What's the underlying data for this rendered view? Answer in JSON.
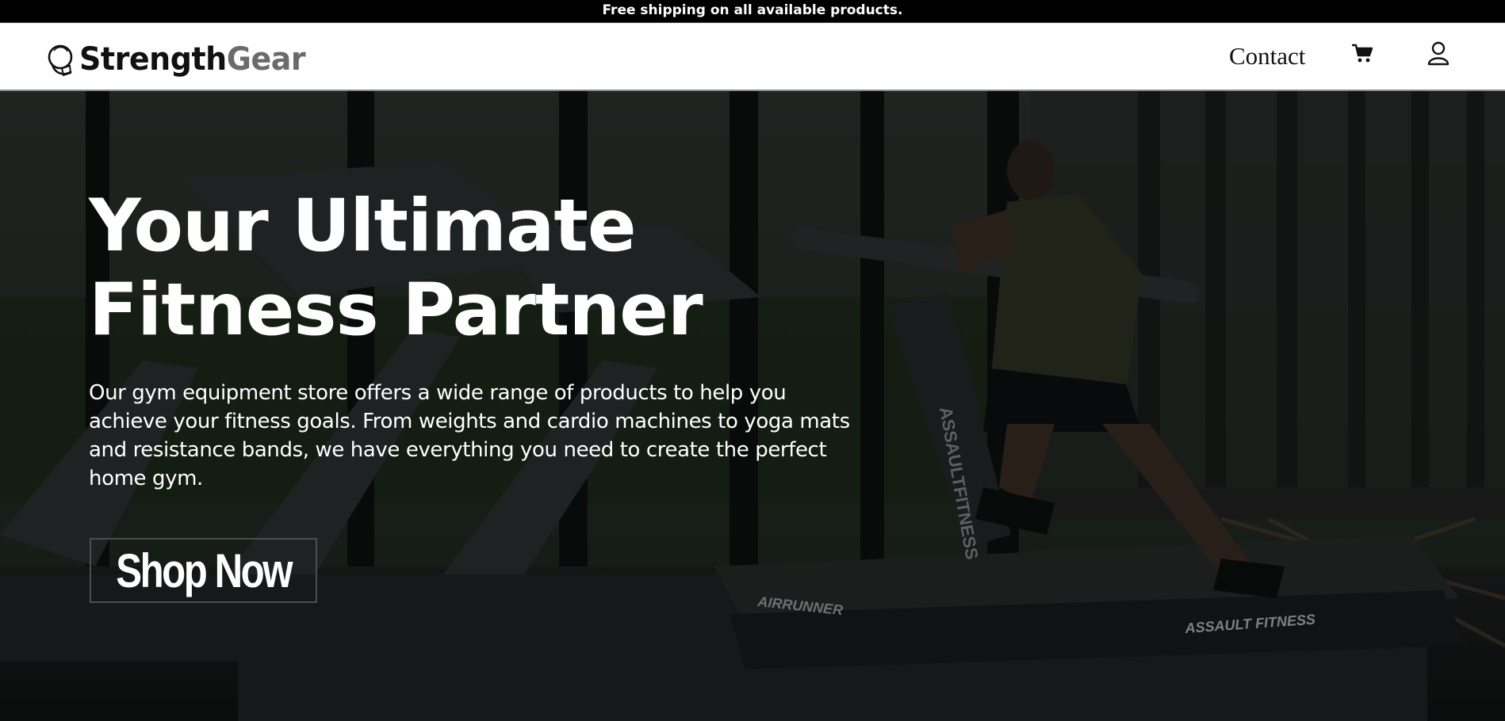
{
  "announcement": {
    "text": "Free shipping on all available products."
  },
  "brand": {
    "part1": "Strength",
    "part2": "Gear"
  },
  "nav": {
    "contact_label": "Contact",
    "cart_icon": "cart-icon",
    "account_icon": "user-icon"
  },
  "hero": {
    "title_line1": "Your Ultimate",
    "title_line2": "Fitness Partner",
    "description": "Our gym equipment store offers a wide range of products to help you achieve your fitness goals. From weights and cardio machines to yoga mats and resistance bands, we have everything you need to create the perfect home gym.",
    "cta_label": "Shop Now",
    "treadmill_brand_1": "AIRRUNNER",
    "treadmill_brand_2": "ASSAULT FITNESS",
    "treadmill_side_text": "ASSAULTFITNESS"
  },
  "colors": {
    "announcement_bg": "#000000",
    "navbar_bg": "#ffffff",
    "brand_secondary": "#6b6b6b",
    "hero_overlay": "#1c1f1e",
    "text_light": "#ffffff"
  }
}
